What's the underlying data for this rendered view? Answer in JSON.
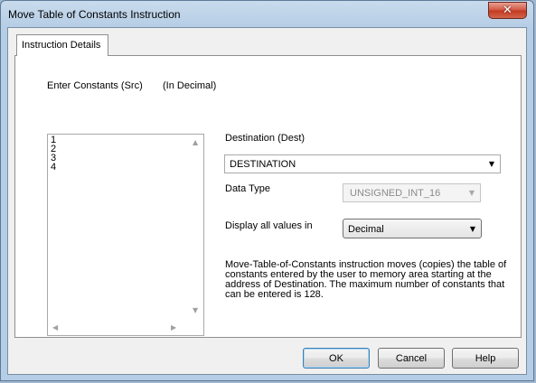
{
  "window": {
    "title": "Move Table of Constants Instruction",
    "close_glyph": "✕"
  },
  "tabs": [
    {
      "label": "Instruction Details",
      "selected": true
    }
  ],
  "source": {
    "label": "Enter Constants (Src)",
    "radix_note": "(In Decimal)",
    "values": [
      "1",
      "2",
      "3",
      "4"
    ],
    "values_text": "1\n2\n3\n4"
  },
  "destination": {
    "label": "Destination (Dest)",
    "value": "DESTINATION"
  },
  "data_type": {
    "label": "Data Type",
    "value": "UNSIGNED_INT_16",
    "enabled": false
  },
  "display": {
    "label": "Display all values in",
    "value": "Decimal"
  },
  "description": "Move-Table-of-Constants instruction moves (copies) the table of constants entered by the user to memory area starting at the address of Destination. The maximum number of constants that can be entered is 128.",
  "buttons": {
    "ok": "OK",
    "cancel": "Cancel",
    "help": "Help"
  },
  "icons": {
    "close": "close-icon",
    "dropdown": "chevron-down-icon",
    "scroll_up": "scroll-up-arrow-icon",
    "scroll_down": "scroll-down-arrow-icon",
    "scroll_left": "scroll-left-arrow-icon",
    "scroll_right": "scroll-right-arrow-icon"
  },
  "colors": {
    "titlebar": "#b5cde5",
    "close_button": "#c8452c",
    "default_button_border": "#3c7fb1"
  }
}
